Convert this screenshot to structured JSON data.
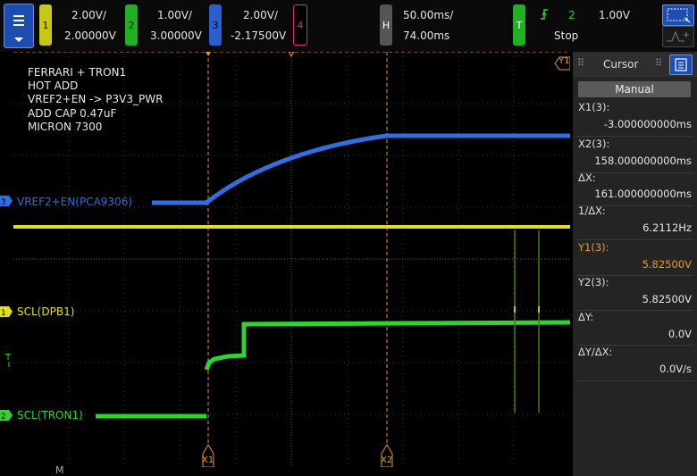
{
  "toolbar": {
    "channels": [
      {
        "number": "1",
        "scale": "2.00V/",
        "offset": "2.00000V",
        "color": "#d9d916"
      },
      {
        "number": "2",
        "scale": "1.00V/",
        "offset": "3.00000V",
        "color": "#2ecc2e"
      },
      {
        "number": "3",
        "scale": "2.00V/",
        "offset": "-2.17500V",
        "color": "#2f6fe0"
      },
      {
        "number": "4",
        "scale": "",
        "offset": "",
        "color": "#e0307a"
      }
    ],
    "horizontal": {
      "key": "H",
      "scale": "50.00ms/",
      "delay": "74.00ms"
    },
    "trigger": {
      "key": "T",
      "source": "2",
      "level": "1.00V",
      "status": "Stop"
    }
  },
  "annotation": [
    "FERRARI + TRON1",
    "HOT ADD",
    "VREF2+EN -> P3V3_PWR",
    "ADD CAP 0.47uF",
    "MICRON 7300"
  ],
  "traces": {
    "ch3_label": "VREF2+EN(PCA9306)",
    "ch1_label": "SCL(DPB1)",
    "ch2_label": "SCL(TRON1)"
  },
  "markers": {
    "x1": "X1",
    "x2": "X2",
    "y1": "Y1"
  },
  "cursor_panel": {
    "title": "Cursor",
    "mode": "Manual",
    "x1_label": "X1(3):",
    "x1_value": "-3.000000000ms",
    "x2_label": "X2(3):",
    "x2_value": "158.000000000ms",
    "dx_label": "ΔX:",
    "dx_value": "161.000000000ms",
    "inv_dx_label": "1/ΔX:",
    "inv_dx_value": "6.2112Hz",
    "y1_label": "Y1(3):",
    "y1_value": "5.82500V",
    "y2_label": "Y2(3):",
    "y2_value": "5.82500V",
    "dy_label": "ΔY:",
    "dy_value": "0.0V",
    "dydx_label": "ΔY/ΔX:",
    "dydx_value": "0.0V/s"
  },
  "colors": {
    "ch1": "#e8e81e",
    "ch2": "#30d430",
    "ch3": "#2f6fe0",
    "cursor": "#e89a2a"
  },
  "bottom_glyph": "M"
}
